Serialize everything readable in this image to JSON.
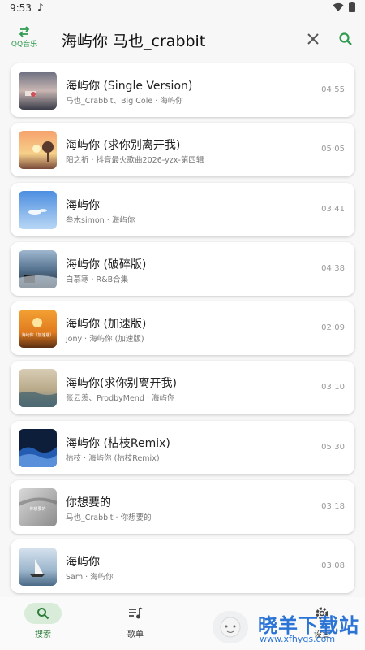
{
  "status": {
    "time": "9:53",
    "note": "♪"
  },
  "header": {
    "source_label": "QQ音乐",
    "search_query": "海屿你 马也_crabbit"
  },
  "songs": [
    {
      "title": "海屿你 (Single Version)",
      "subtitle": "马也_Crabbit、Big Cole · 海屿你",
      "duration": "04:55",
      "cover": "dusk-road"
    },
    {
      "title": "海屿你 (求你别离开我)",
      "subtitle": "阳之祈 · 抖音最火歌曲2026-yzx-第四辑",
      "duration": "05:05",
      "cover": "sunset-tree"
    },
    {
      "title": "海屿你",
      "subtitle": "叁木simon · 海屿你",
      "duration": "03:41",
      "cover": "blue-sky"
    },
    {
      "title": "海屿你 (破碎版)",
      "subtitle": "白慕寒 · R&B合集",
      "duration": "04:38",
      "cover": "piano-sea"
    },
    {
      "title": "海屿你 (加速版)",
      "subtitle": "jony · 海屿你 (加速版)",
      "duration": "02:09",
      "cover": "orange-sunset",
      "cover_text": "海屿你（加速版）"
    },
    {
      "title": "海屿你(求你别离开我)",
      "subtitle": "张云羡、ProdbyMend · 海屿你",
      "duration": "03:10",
      "cover": "beach-waves"
    },
    {
      "title": "海屿你 (枯枝Remix)",
      "subtitle": "枯枝 · 海屿你 (枯枝Remix)",
      "duration": "05:30",
      "cover": "blue-waves"
    },
    {
      "title": "你想要的",
      "subtitle": "马也_Crabbit · 你想要的",
      "duration": "03:18",
      "cover": "grey-fog",
      "cover_text": "你想要的"
    },
    {
      "title": "海屿你",
      "subtitle": "Sam · 海屿你",
      "duration": "03:08",
      "cover": "sailboat"
    }
  ],
  "nav": [
    {
      "label": "搜索",
      "icon": "search-icon",
      "active": true
    },
    {
      "label": "歌单",
      "icon": "playlist-icon",
      "active": false
    },
    {
      "label": "设置",
      "icon": "gear-icon",
      "active": false
    }
  ],
  "watermark": {
    "text": "晓羊下载站",
    "url": "www.xfhygs.com"
  },
  "colors": {
    "accent": "#2e9b4e",
    "nav_active_bg": "#d8ecd9",
    "watermark": "#2b74d6"
  }
}
